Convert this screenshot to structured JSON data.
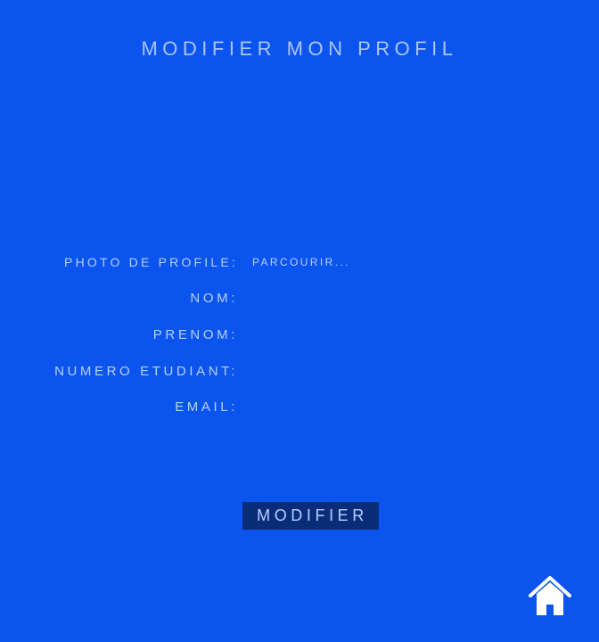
{
  "header": {
    "title": "MODIFIER MON PROFIL"
  },
  "form": {
    "photo_label": "PHOTO DE PROFILE:",
    "photo_button": "PARCOURIR...",
    "nom_label": "NOM:",
    "nom_value": "",
    "prenom_label": "PRENOM:",
    "prenom_value": "",
    "numero_label": "NUMERO ETUDIANT:",
    "numero_value": "",
    "email_label": "EMAIL:",
    "email_value": "",
    "submit_label": "MODIFIER"
  },
  "icons": {
    "home": "home-icon"
  },
  "colors": {
    "background": "#0b55ee",
    "text": "#b8cfff",
    "button": "#0a2d7a",
    "icon": "#ffffff"
  }
}
